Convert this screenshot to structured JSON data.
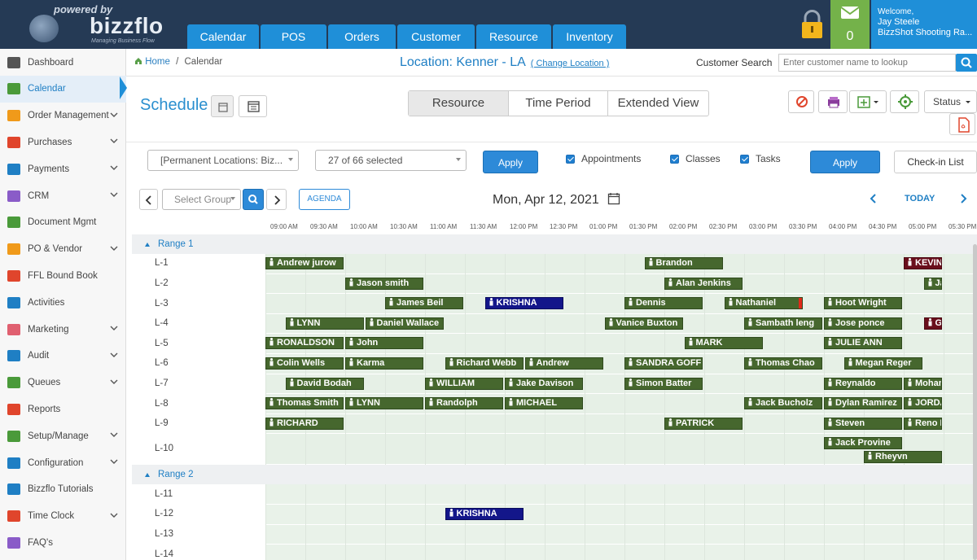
{
  "header": {
    "logo_powered": "powered by",
    "logo_name": "bizzflo",
    "logo_tagline": "Managing Business Flow",
    "nav": [
      "Calendar",
      "POS",
      "Orders",
      "Customer",
      "Resource",
      "Inventory"
    ],
    "mail_count": "0",
    "welcome_line": "Welcome,",
    "user_name": "Jay Steele",
    "business": "BizzShot Shooting Ra..."
  },
  "sidebar": {
    "items": [
      {
        "label": "Dashboard",
        "icon": "dashboard-icon",
        "chevron": false
      },
      {
        "label": "Calendar",
        "icon": "calendar-icon",
        "chevron": false
      },
      {
        "label": "Order Management",
        "icon": "cart-icon",
        "chevron": true
      },
      {
        "label": "Purchases",
        "icon": "edit-icon",
        "chevron": true
      },
      {
        "label": "Payments",
        "icon": "dollar-icon",
        "chevron": true
      },
      {
        "label": "CRM",
        "icon": "users-icon",
        "chevron": true
      },
      {
        "label": "Document Mgmt",
        "icon": "document-icon",
        "chevron": false
      },
      {
        "label": "PO & Vendor",
        "icon": "list-icon",
        "chevron": true
      },
      {
        "label": "FFL Bound Book",
        "icon": "book-icon",
        "chevron": false
      },
      {
        "label": "Activities",
        "icon": "pencil-icon",
        "chevron": false
      },
      {
        "label": "Marketing",
        "icon": "envelope-icon",
        "chevron": true
      },
      {
        "label": "Audit",
        "icon": "audit-icon",
        "chevron": true
      },
      {
        "label": "Queues",
        "icon": "queue-icon",
        "chevron": true
      },
      {
        "label": "Reports",
        "icon": "bar-chart-icon",
        "chevron": false
      },
      {
        "label": "Setup/Manage",
        "icon": "gears-icon",
        "chevron": true
      },
      {
        "label": "Configuration",
        "icon": "wrench-icon",
        "chevron": true
      },
      {
        "label": "Bizzflo Tutorials",
        "icon": "tutorial-icon",
        "chevron": false
      },
      {
        "label": "Time Clock",
        "icon": "clock-icon",
        "chevron": true
      },
      {
        "label": "FAQ's",
        "icon": "question-icon",
        "chevron": false
      }
    ]
  },
  "crumb": {
    "home": "Home",
    "sep": "/",
    "current": "Calendar"
  },
  "location": {
    "label": "Location: Kenner - LA",
    "change": "( Change Location )"
  },
  "customer_search": {
    "label": "Customer Search",
    "placeholder": "Enter customer name to lookup"
  },
  "schedule": {
    "title": "Schedule",
    "views": [
      "Resource",
      "Time Period",
      "Extended View"
    ],
    "active_view": "Resource",
    "status_label": "Status"
  },
  "filters": {
    "locations": "[Permanent Locations: Biz...",
    "selection": "27 of 66 selected",
    "apply": "Apply",
    "checks": [
      "Appointments",
      "Classes",
      "Tasks"
    ],
    "apply2": "Apply",
    "checkin": "Check-in List"
  },
  "datenav": {
    "group_placeholder": "Select Group",
    "agenda": "AGENDA",
    "date": "Mon, Apr 12, 2021",
    "today": "TODAY"
  },
  "times": [
    "09:00 AM",
    "09:30 AM",
    "10:00 AM",
    "10:30 AM",
    "11:00 AM",
    "11:30 AM",
    "12:00 PM",
    "12:30 PM",
    "01:00 PM",
    "01:30 PM",
    "02:00 PM",
    "02:30 PM",
    "03:00 PM",
    "03:30 PM",
    "04:00 PM",
    "04:30 PM",
    "05:00 PM",
    "05:30 PM"
  ],
  "ranges": [
    {
      "name": "Range 1",
      "rows": [
        "L-1",
        "L-2",
        "L-3",
        "L-4",
        "L-5",
        "L-6",
        "L-7",
        "L-8",
        "L-9",
        "L-10"
      ]
    },
    {
      "name": "Range 2",
      "rows": [
        "L-11",
        "L-12",
        "L-13",
        "L-14"
      ]
    }
  ],
  "colors": {
    "event_green": "#46672e",
    "event_blue": "#13168a",
    "event_maroon": "#6a0f1c",
    "accent": "#1f8fd8"
  },
  "events": [
    {
      "name": "Andrew jurow",
      "row": "L-1",
      "start": "09:00 AM",
      "end": "10:00 AM"
    },
    {
      "name": "Brandon",
      "row": "L-1",
      "start": "01:45 PM",
      "end": "02:45 PM"
    },
    {
      "name": "KEVIN",
      "row": "L-1",
      "start": "05:00 PM",
      "end": "05:30 PM",
      "color": "maroon"
    },
    {
      "name": "Jason smith",
      "row": "L-2",
      "start": "10:00 AM",
      "end": "11:00 AM"
    },
    {
      "name": "Alan Jenkins",
      "row": "L-2",
      "start": "02:00 PM",
      "end": "03:00 PM"
    },
    {
      "name": "Ja",
      "row": "L-2",
      "start": "05:15 PM",
      "end": "05:30 PM"
    },
    {
      "name": "James Beil",
      "row": "L-3",
      "start": "10:30 AM",
      "end": "11:30 AM"
    },
    {
      "name": "KRISHNA",
      "row": "L-3",
      "start": "11:45 AM",
      "end": "12:45 PM",
      "color": "blue"
    },
    {
      "name": "Dennis",
      "row": "L-3",
      "start": "01:30 PM",
      "end": "02:30 PM"
    },
    {
      "name": "Nathaniel",
      "row": "L-3",
      "start": "02:45 PM",
      "end": "03:45 PM"
    },
    {
      "name": "Hoot Wright",
      "row": "L-3",
      "start": "04:00 PM",
      "end": "05:00 PM"
    },
    {
      "name": "LYNN",
      "row": "L-4",
      "start": "09:15 AM",
      "end": "10:15 AM"
    },
    {
      "name": "Daniel Wallace",
      "row": "L-4",
      "start": "10:15 AM",
      "end": "11:15 AM"
    },
    {
      "name": "Vanice Buxton",
      "row": "L-4",
      "start": "01:15 PM",
      "end": "02:15 PM"
    },
    {
      "name": "Sambath leng",
      "row": "L-4",
      "start": "03:00 PM",
      "end": "04:00 PM"
    },
    {
      "name": "Jose ponce",
      "row": "L-4",
      "start": "04:00 PM",
      "end": "05:00 PM"
    },
    {
      "name": "G",
      "row": "L-4",
      "start": "05:15 PM",
      "end": "05:30 PM",
      "color": "maroon"
    },
    {
      "name": "RONALDSON",
      "row": "L-5",
      "start": "09:00 AM",
      "end": "10:00 AM"
    },
    {
      "name": "John",
      "row": "L-5",
      "start": "10:00 AM",
      "end": "11:00 AM"
    },
    {
      "name": "MARK",
      "row": "L-5",
      "start": "02:15 PM",
      "end": "03:15 PM"
    },
    {
      "name": "JULIE ANN",
      "row": "L-5",
      "start": "04:00 PM",
      "end": "05:00 PM"
    },
    {
      "name": "Colin Wells",
      "row": "L-6",
      "start": "09:00 AM",
      "end": "10:00 AM"
    },
    {
      "name": "Karma",
      "row": "L-6",
      "start": "10:00 AM",
      "end": "11:00 AM"
    },
    {
      "name": "Richard Webb",
      "row": "L-6",
      "start": "11:15 AM",
      "end": "12:15 PM"
    },
    {
      "name": "Andrew",
      "row": "L-6",
      "start": "12:15 PM",
      "end": "01:15 PM"
    },
    {
      "name": "SANDRA GOFF",
      "row": "L-6",
      "start": "01:30 PM",
      "end": "02:30 PM"
    },
    {
      "name": "Thomas Chao",
      "row": "L-6",
      "start": "03:00 PM",
      "end": "04:00 PM"
    },
    {
      "name": "Megan Reger",
      "row": "L-6",
      "start": "04:15 PM",
      "end": "05:15 PM"
    },
    {
      "name": "David Bodah",
      "row": "L-7",
      "start": "09:15 AM",
      "end": "10:15 AM"
    },
    {
      "name": "WILLIAM",
      "row": "L-7",
      "start": "11:00 AM",
      "end": "12:00 PM"
    },
    {
      "name": "Jake Davison",
      "row": "L-7",
      "start": "12:00 PM",
      "end": "01:00 PM"
    },
    {
      "name": "Simon Batter",
      "row": "L-7",
      "start": "01:30 PM",
      "end": "02:30 PM"
    },
    {
      "name": "Reynaldo",
      "row": "L-7",
      "start": "04:00 PM",
      "end": "05:00 PM"
    },
    {
      "name": "Mohamoud",
      "row": "L-7",
      "start": "05:00 PM",
      "end": "05:30 PM"
    },
    {
      "name": "Thomas Smith",
      "row": "L-8",
      "start": "09:00 AM",
      "end": "10:00 AM"
    },
    {
      "name": "LYNN",
      "row": "L-8",
      "start": "10:00 AM",
      "end": "11:00 AM"
    },
    {
      "name": "Randolph",
      "row": "L-8",
      "start": "11:00 AM",
      "end": "12:00 PM"
    },
    {
      "name": "MICHAEL",
      "row": "L-8",
      "start": "12:00 PM",
      "end": "01:00 PM"
    },
    {
      "name": "Jack Bucholz",
      "row": "L-8",
      "start": "03:00 PM",
      "end": "04:00 PM"
    },
    {
      "name": "Dylan Ramirez",
      "row": "L-8",
      "start": "04:00 PM",
      "end": "05:00 PM"
    },
    {
      "name": "JORDAN",
      "row": "L-8",
      "start": "05:00 PM",
      "end": "05:30 PM"
    },
    {
      "name": "RICHARD",
      "row": "L-9",
      "start": "09:00 AM",
      "end": "10:00 AM"
    },
    {
      "name": "PATRICK",
      "row": "L-9",
      "start": "02:00 PM",
      "end": "03:00 PM"
    },
    {
      "name": "Steven",
      "row": "L-9",
      "start": "04:00 PM",
      "end": "05:00 PM"
    },
    {
      "name": "Reno NORNI",
      "row": "L-9",
      "start": "05:00 PM",
      "end": "05:30 PM"
    },
    {
      "name": "Jack Provine",
      "row": "L-10",
      "start": "04:00 PM",
      "end": "05:00 PM",
      "lane": 0
    },
    {
      "name": "Rheyvn",
      "row": "L-10",
      "start": "04:30 PM",
      "end": "05:30 PM",
      "lane": 1
    },
    {
      "name": "KRISHNA",
      "row": "L-12",
      "start": "11:15 AM",
      "end": "12:15 PM",
      "color": "blue"
    }
  ]
}
